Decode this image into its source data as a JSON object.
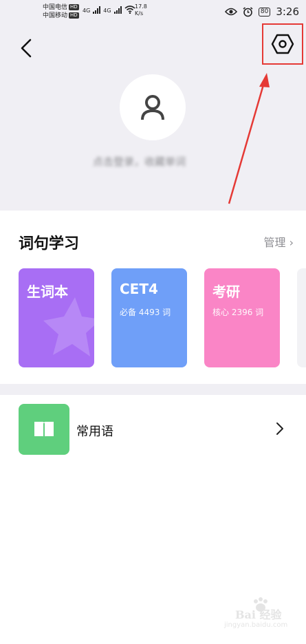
{
  "status_bar": {
    "carrier_1": "中国电信",
    "carrier_2": "中国移动",
    "hd_badge": "HD",
    "network_1": "4G",
    "network_2": "4G",
    "speed_value": "17.8",
    "speed_unit": "K/s",
    "battery": "80",
    "time": "3:26"
  },
  "header": {
    "login_prompt": "点击登录，收藏单词"
  },
  "study": {
    "title": "词句学习",
    "manage_label": "管理 ›",
    "tiles": [
      {
        "title": "生词本",
        "subtitle": ""
      },
      {
        "title": "CET4",
        "subtitle": "必备 4493 词"
      },
      {
        "title": "考研",
        "subtitle": "核心 2396 词"
      }
    ]
  },
  "phrases": {
    "label": "常用语"
  },
  "watermark": {
    "brand": "Bai 经验",
    "url": "jingyan.baidu.com"
  },
  "colors": {
    "annotation": "#e53935",
    "vocab_tile": "#a86ef4",
    "cet4_tile": "#6f9ff8",
    "kaoyan_tile": "#fa85c6",
    "phrases_icon": "#5fcf7d"
  }
}
